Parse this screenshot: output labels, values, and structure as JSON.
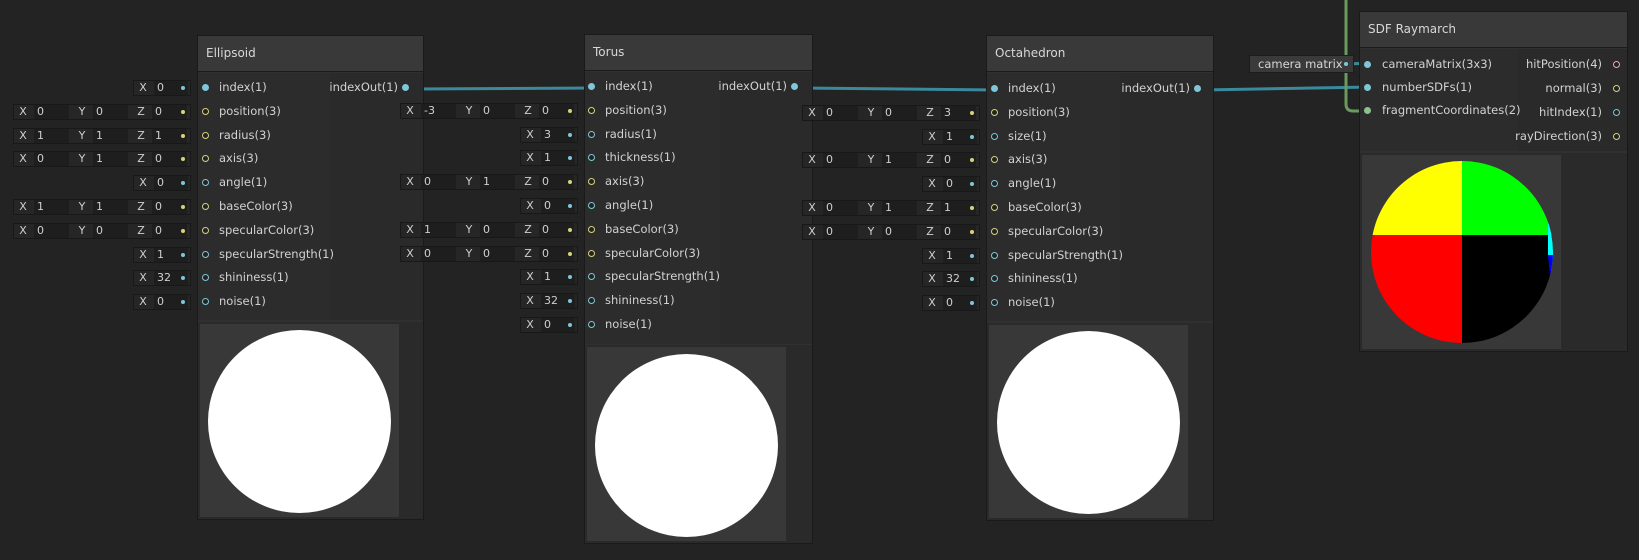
{
  "nodes": {
    "ellipsoid": {
      "title": "Ellipsoid",
      "inputs": [
        {
          "label": "index(1)",
          "color": "blue",
          "fields": [
            {
              "axis": "X",
              "value": "0"
            }
          ]
        },
        {
          "label": "position(3)",
          "color": "yellow",
          "fields": [
            {
              "axis": "X",
              "value": "0"
            },
            {
              "axis": "Y",
              "value": "0"
            },
            {
              "axis": "Z",
              "value": "0"
            }
          ]
        },
        {
          "label": "radius(3)",
          "color": "yellow",
          "fields": [
            {
              "axis": "X",
              "value": "1"
            },
            {
              "axis": "Y",
              "value": "1"
            },
            {
              "axis": "Z",
              "value": "1"
            }
          ]
        },
        {
          "label": "axis(3)",
          "color": "yellow",
          "fields": [
            {
              "axis": "X",
              "value": "0"
            },
            {
              "axis": "Y",
              "value": "1"
            },
            {
              "axis": "Z",
              "value": "0"
            }
          ]
        },
        {
          "label": "angle(1)",
          "color": "blue",
          "fields": [
            {
              "axis": "X",
              "value": "0"
            }
          ]
        },
        {
          "label": "baseColor(3)",
          "color": "yellow",
          "fields": [
            {
              "axis": "X",
              "value": "1"
            },
            {
              "axis": "Y",
              "value": "1"
            },
            {
              "axis": "Z",
              "value": "0"
            }
          ]
        },
        {
          "label": "specularColor(3)",
          "color": "yellow",
          "fields": [
            {
              "axis": "X",
              "value": "0"
            },
            {
              "axis": "Y",
              "value": "0"
            },
            {
              "axis": "Z",
              "value": "0"
            }
          ]
        },
        {
          "label": "specularStrength(1)",
          "color": "blue",
          "fields": [
            {
              "axis": "X",
              "value": "1"
            }
          ]
        },
        {
          "label": "shininess(1)",
          "color": "blue",
          "fields": [
            {
              "axis": "X",
              "value": "32"
            }
          ]
        },
        {
          "label": "noise(1)",
          "color": "blue",
          "fields": [
            {
              "axis": "X",
              "value": "0"
            }
          ]
        }
      ],
      "output": "indexOut(1)"
    },
    "torus": {
      "title": "Torus",
      "inputs": [
        {
          "label": "index(1)",
          "color": "blue",
          "fields": []
        },
        {
          "label": "position(3)",
          "color": "yellow",
          "fields": [
            {
              "axis": "X",
              "value": "-3"
            },
            {
              "axis": "Y",
              "value": "0"
            },
            {
              "axis": "Z",
              "value": "0"
            }
          ]
        },
        {
          "label": "radius(1)",
          "color": "blue",
          "fields": [
            {
              "axis": "X",
              "value": "3"
            }
          ]
        },
        {
          "label": "thickness(1)",
          "color": "blue",
          "fields": [
            {
              "axis": "X",
              "value": "1"
            }
          ]
        },
        {
          "label": "axis(3)",
          "color": "yellow",
          "fields": [
            {
              "axis": "X",
              "value": "0"
            },
            {
              "axis": "Y",
              "value": "1"
            },
            {
              "axis": "Z",
              "value": "0"
            }
          ]
        },
        {
          "label": "angle(1)",
          "color": "blue",
          "fields": [
            {
              "axis": "X",
              "value": "0"
            }
          ]
        },
        {
          "label": "baseColor(3)",
          "color": "yellow",
          "fields": [
            {
              "axis": "X",
              "value": "1"
            },
            {
              "axis": "Y",
              "value": "0"
            },
            {
              "axis": "Z",
              "value": "0"
            }
          ]
        },
        {
          "label": "specularColor(3)",
          "color": "yellow",
          "fields": [
            {
              "axis": "X",
              "value": "0"
            },
            {
              "axis": "Y",
              "value": "0"
            },
            {
              "axis": "Z",
              "value": "0"
            }
          ]
        },
        {
          "label": "specularStrength(1)",
          "color": "blue",
          "fields": [
            {
              "axis": "X",
              "value": "1"
            }
          ]
        },
        {
          "label": "shininess(1)",
          "color": "blue",
          "fields": [
            {
              "axis": "X",
              "value": "32"
            }
          ]
        },
        {
          "label": "noise(1)",
          "color": "blue",
          "fields": [
            {
              "axis": "X",
              "value": "0"
            }
          ]
        }
      ],
      "output": "indexOut(1)"
    },
    "octahedron": {
      "title": "Octahedron",
      "inputs": [
        {
          "label": "index(1)",
          "color": "blue",
          "fields": []
        },
        {
          "label": "position(3)",
          "color": "yellow",
          "fields": [
            {
              "axis": "X",
              "value": "0"
            },
            {
              "axis": "Y",
              "value": "0"
            },
            {
              "axis": "Z",
              "value": "3"
            }
          ]
        },
        {
          "label": "size(1)",
          "color": "blue",
          "fields": [
            {
              "axis": "X",
              "value": "1"
            }
          ]
        },
        {
          "label": "axis(3)",
          "color": "yellow",
          "fields": [
            {
              "axis": "X",
              "value": "0"
            },
            {
              "axis": "Y",
              "value": "1"
            },
            {
              "axis": "Z",
              "value": "0"
            }
          ]
        },
        {
          "label": "angle(1)",
          "color": "blue",
          "fields": [
            {
              "axis": "X",
              "value": "0"
            }
          ]
        },
        {
          "label": "baseColor(3)",
          "color": "yellow",
          "fields": [
            {
              "axis": "X",
              "value": "0"
            },
            {
              "axis": "Y",
              "value": "1"
            },
            {
              "axis": "Z",
              "value": "1"
            }
          ]
        },
        {
          "label": "specularColor(3)",
          "color": "yellow",
          "fields": [
            {
              "axis": "X",
              "value": "0"
            },
            {
              "axis": "Y",
              "value": "0"
            },
            {
              "axis": "Z",
              "value": "0"
            }
          ]
        },
        {
          "label": "specularStrength(1)",
          "color": "blue",
          "fields": [
            {
              "axis": "X",
              "value": "1"
            }
          ]
        },
        {
          "label": "shininess(1)",
          "color": "blue",
          "fields": [
            {
              "axis": "X",
              "value": "32"
            }
          ]
        },
        {
          "label": "noise(1)",
          "color": "blue",
          "fields": [
            {
              "axis": "X",
              "value": "0"
            }
          ]
        }
      ],
      "output": "indexOut(1)"
    },
    "raymarch": {
      "title": "SDF Raymarch",
      "inputs": [
        {
          "label": "cameraMatrix(3x3)",
          "color": "blue"
        },
        {
          "label": "numberSDFs(1)",
          "color": "blue"
        },
        {
          "label": "fragmentCoordinates(2)",
          "color": "green"
        }
      ],
      "outputs": [
        {
          "label": "hitPosition(4)",
          "color": "pink"
        },
        {
          "label": "normal(3)",
          "color": "yellow"
        },
        {
          "label": "hitIndex(1)",
          "color": "blue"
        },
        {
          "label": "rayDirection(3)",
          "color": "yellow"
        }
      ]
    }
  },
  "camera_matrix": {
    "label": "camera matrix"
  },
  "colors": {
    "background": "#232323",
    "wire_blue": "#3a8a9c",
    "wire_green": "#6b9a5f",
    "port_blue": "#7fc7d8",
    "port_yellow": "#d8d27e",
    "port_green": "#8bc28b",
    "port_pink": "#e6a6d0"
  }
}
